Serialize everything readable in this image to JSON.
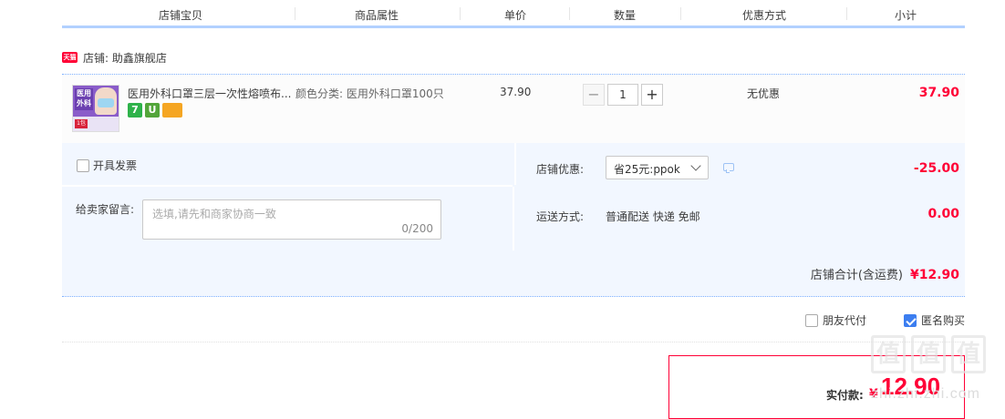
{
  "header": {
    "columns": [
      "店铺宝贝",
      "商品属性",
      "单价",
      "数量",
      "优惠方式",
      "小计"
    ]
  },
  "shop": {
    "badge": "天猫",
    "name": "店铺: 助鑫旗舰店"
  },
  "item": {
    "thumb_text": "医用外科",
    "thumb_tag": "1包",
    "title": "医用外科口罩三层一次性熔喷布...",
    "attribute": "颜色分类: 医用外科口罩100只",
    "price": "37.90",
    "quantity": "1",
    "qty_minus": "−",
    "qty_plus": "+",
    "promo": "无优惠",
    "subtotal": "37.90",
    "icons": [
      "7",
      "U"
    ]
  },
  "order": {
    "invoice_label": "开具发票",
    "message_label": "给卖家留言:",
    "message_placeholder": "选填,请先和商家协商一致",
    "message_count": "0/200",
    "shop_discount_label": "店铺优惠:",
    "shop_discount_value": "省25元:ppok",
    "shop_discount_amount": "-25.00",
    "shipping_label": "运送方式:",
    "shipping_value": "普通配送 快递 免邮",
    "shipping_amount": "0.00",
    "total_label": "店铺合计(含运费)",
    "total_value": "¥12.90"
  },
  "options": {
    "friend_pay": "朋友代付",
    "anonymous": "匿名购买"
  },
  "pay": {
    "label": "实付款:",
    "currency": "¥",
    "amount": "12.90"
  },
  "watermark": {
    "chars": [
      "值",
      "值",
      "值"
    ],
    "site": "zhi.zhi.zhi.com"
  },
  "colors": {
    "price_red": "#ff0036",
    "panel_bg": "#f2f7ff",
    "header_line": "#b2d1ff",
    "check_blue": "#3c7ef0"
  }
}
